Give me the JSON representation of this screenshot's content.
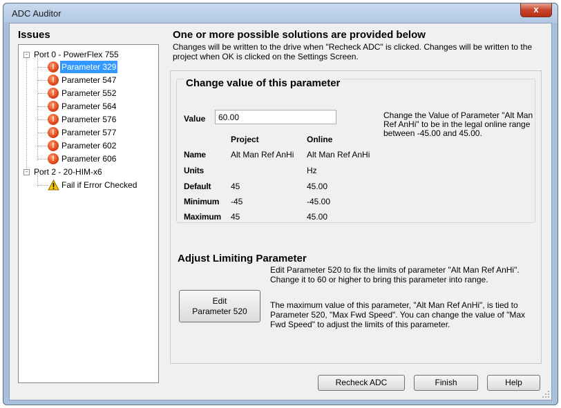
{
  "window": {
    "title": "ADC Auditor",
    "close_symbol": "x"
  },
  "issues": {
    "heading": "Issues",
    "tree": {
      "port0": {
        "label": "Port 0 - PowerFlex 755",
        "expander": "-"
      },
      "port0_items": [
        {
          "label": "Parameter 329",
          "selected": true
        },
        {
          "label": "Parameter 547"
        },
        {
          "label": "Parameter 552"
        },
        {
          "label": "Parameter 564"
        },
        {
          "label": "Parameter 576"
        },
        {
          "label": "Parameter 577"
        },
        {
          "label": "Parameter 602"
        },
        {
          "label": "Parameter 606"
        }
      ],
      "port2": {
        "label": "Port 2 - 20-HIM-x6",
        "expander": "-"
      },
      "port2_items": [
        {
          "label": "Fail if Error Checked"
        }
      ],
      "error_glyph": "!"
    }
  },
  "solutions": {
    "heading": "One or more possible solutions are provided below",
    "description": "Changes will be written to the drive when \"Recheck ADC\" is clicked.  Changes will be written to the project when OK is clicked on the Settings Screen."
  },
  "change_value": {
    "title": "Change value of this parameter",
    "value_label": "Value",
    "value": "60.00",
    "help": "Change the Value of Parameter \"Alt Man Ref AnHi\" to be in the legal online range between -45.00 and 45.00.",
    "columns": {
      "project": "Project",
      "online": "Online"
    },
    "rows": [
      {
        "label": "Name",
        "project": "Alt Man Ref AnHi",
        "online": "Alt Man Ref AnHi"
      },
      {
        "label": "Units",
        "project": "",
        "online": "Hz"
      },
      {
        "label": "Default",
        "project": "45",
        "online": "45.00"
      },
      {
        "label": "Minimum",
        "project": "-45",
        "online": "-45.00"
      },
      {
        "label": "Maximum",
        "project": "45",
        "online": "45.00"
      }
    ]
  },
  "adjust_limit": {
    "title": "Adjust Limiting Parameter",
    "button_line1": "Edit",
    "button_line2": "Parameter 520",
    "text1": "Edit Parameter 520 to fix the limits of parameter \"Alt Man Ref AnHi\".  Change it to 60 or higher to bring this parameter into range.",
    "text2": "The maximum value of this parameter, \"Alt Man Ref AnHi\", is tied to Parameter 520, \"Max Fwd Speed\".  You can change the value of \"Max Fwd Speed\" to adjust the limits of this parameter."
  },
  "footer": {
    "recheck": "Recheck ADC",
    "finish": "Finish",
    "help": "Help"
  },
  "colors": {
    "selection": "#3399ff",
    "error": "#e0461b",
    "warning": "#f5c400",
    "close": "#c8452c"
  },
  "icons": {
    "error": "error-icon",
    "warning": "warning-icon",
    "close": "close-icon",
    "expander": "collapse-icon"
  }
}
